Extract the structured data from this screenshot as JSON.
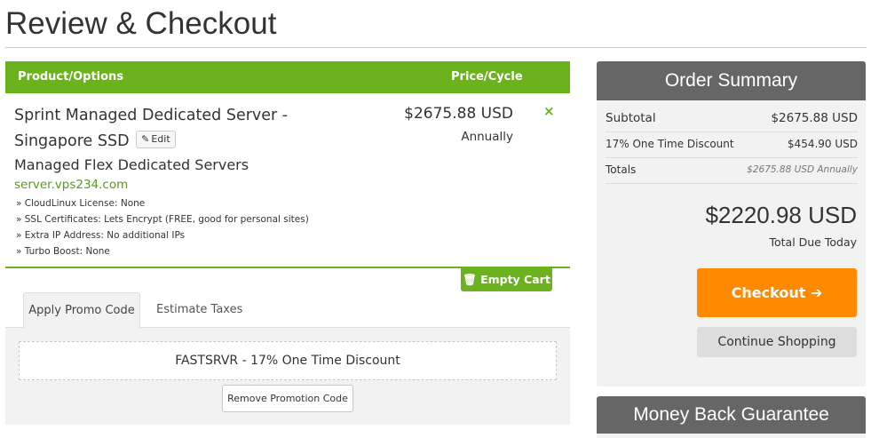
{
  "page": {
    "title": "Review & Checkout"
  },
  "cart": {
    "header": {
      "product_col": "Product/Options",
      "price_col": "Price/Cycle"
    },
    "item": {
      "name_line1": "Sprint Managed Dedicated Server -",
      "name_line2": "Singapore SSD",
      "edit_label": "Edit",
      "group": "Managed Flex Dedicated Servers",
      "domain": "server.vps234.com",
      "options": [
        "» CloudLinux License: None",
        "» SSL Certificates: Lets Encrypt (FREE, good for personal sites)",
        "» Extra IP Address: No additional IPs",
        "» Turbo Boost: None"
      ],
      "price": "$2675.88 USD",
      "cycle": "Annually",
      "remove_icon": "×"
    },
    "empty_cart_label": "Empty Cart"
  },
  "promo": {
    "tabs": [
      {
        "label": "Apply Promo Code",
        "active": true
      },
      {
        "label": "Estimate Taxes",
        "active": false
      }
    ],
    "applied_code": "FASTSRVR - 17% One Time Discount",
    "remove_label": "Remove Promotion Code"
  },
  "summary": {
    "title": "Order Summary",
    "subtotal_label": "Subtotal",
    "subtotal_value": "$2675.88 USD",
    "discount_label": "17% One Time Discount",
    "discount_value": "$454.90 USD",
    "totals_label": "Totals",
    "totals_value": "$2675.88 USD Annually",
    "total_due": "$2220.98 USD",
    "total_due_label": "Total Due Today",
    "checkout_label": "Checkout",
    "continue_label": "Continue Shopping"
  },
  "guarantee": {
    "title": "Money Back Guarantee"
  },
  "colors": {
    "green": "#6cb21e",
    "orange": "#ff8a00",
    "panel_header": "#666666"
  }
}
